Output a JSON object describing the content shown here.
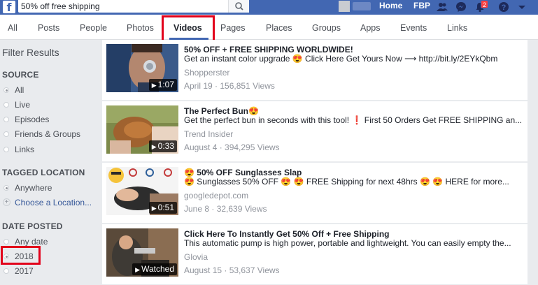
{
  "search": {
    "value": "50% off free shipping"
  },
  "topnav": {
    "home": "Home",
    "user_short": "FBP",
    "notification_count": "2"
  },
  "tabs": [
    {
      "label": "All"
    },
    {
      "label": "Posts"
    },
    {
      "label": "People"
    },
    {
      "label": "Photos"
    },
    {
      "label": "Videos",
      "active": true
    },
    {
      "label": "Pages"
    },
    {
      "label": "Places"
    },
    {
      "label": "Groups"
    },
    {
      "label": "Apps"
    },
    {
      "label": "Events"
    },
    {
      "label": "Links"
    }
  ],
  "sidebar": {
    "title": "Filter Results",
    "source": {
      "heading": "SOURCE",
      "options": [
        "All",
        "Live",
        "Episodes",
        "Friends & Groups",
        "Links"
      ],
      "selected": "All"
    },
    "tagged_location": {
      "heading": "TAGGED LOCATION",
      "options": [
        "Anywhere",
        "Choose a Location..."
      ],
      "selected": "Anywhere"
    },
    "date_posted": {
      "heading": "DATE POSTED",
      "options": [
        "Any date",
        "2018",
        "2017"
      ],
      "selected": "2018"
    }
  },
  "videos": [
    {
      "title": "50% OFF + FREE SHIPPING WORLDWIDE!",
      "description": "Get an instant color upgrade 😍 Click Here Get Yours Now ⟶ http://bit.ly/2EYkQbm",
      "source": "Shopperster",
      "meta": "April 19 · 156,851 Views",
      "duration": "1:07"
    },
    {
      "title": "The Perfect Bun😍",
      "description": "Get the perfect bun in seconds with this tool! ❗ First 50 Orders Get FREE SHIPPING an...",
      "source": "Trend Insider",
      "meta": "August 4 · 394,295 Views",
      "duration": "0:33"
    },
    {
      "title": "😍 50% OFF Sunglasses Slap",
      "description": "😍 Sunglasses 50% OFF 😍 😍 FREE Shipping for next 48hrs 😍 😍 HERE for more...",
      "source": "googledepot.com",
      "meta": "June 8 · 32,639 Views",
      "duration": "0:51"
    },
    {
      "title": "Click Here To Instantly Get 50% Off + Free Shipping",
      "description": "This automatic pump is high power, portable and lightweight. You can easily empty the...",
      "source": "Glovia",
      "meta": "August 15 · 53,637 Views",
      "duration": "Watched"
    }
  ],
  "colors": {
    "brand_blue": "#4267b2",
    "highlight_red": "#e2001a",
    "link_blue": "#365899"
  }
}
